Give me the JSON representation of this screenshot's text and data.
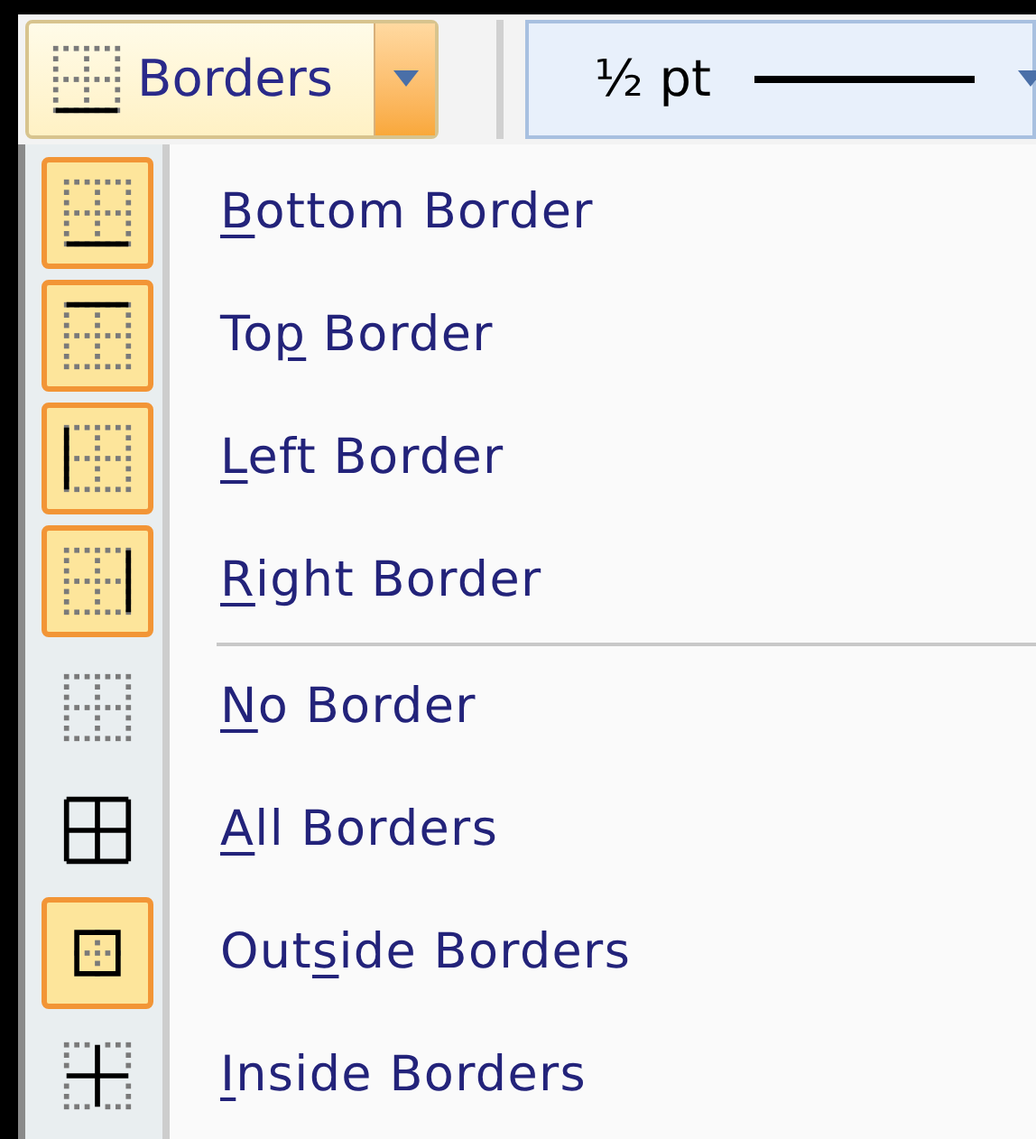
{
  "toolbar": {
    "borders_button": {
      "label": "Borders",
      "kind": "bottom"
    },
    "line_weight": {
      "value": "½ pt"
    }
  },
  "menu": {
    "items": [
      {
        "kind": "bottom",
        "key": "B",
        "post": "ottom Border",
        "checked": true
      },
      {
        "kind": "top",
        "pre": "To",
        "key": "p",
        "post": " Border",
        "checked": true
      },
      {
        "kind": "left",
        "key": "L",
        "post": "eft Border",
        "checked": true
      },
      {
        "kind": "right",
        "key": "R",
        "post": "ight Border",
        "checked": true,
        "separator_after": true
      },
      {
        "kind": "none",
        "key": "N",
        "post": "o Border",
        "checked": false
      },
      {
        "kind": "all",
        "key": "A",
        "post": "ll Borders",
        "checked": false
      },
      {
        "kind": "outside",
        "pre": "Out",
        "key": "s",
        "post": "ide Borders",
        "checked": true
      },
      {
        "kind": "inside",
        "key": "I",
        "post": "nside Borders",
        "checked": false
      }
    ]
  }
}
